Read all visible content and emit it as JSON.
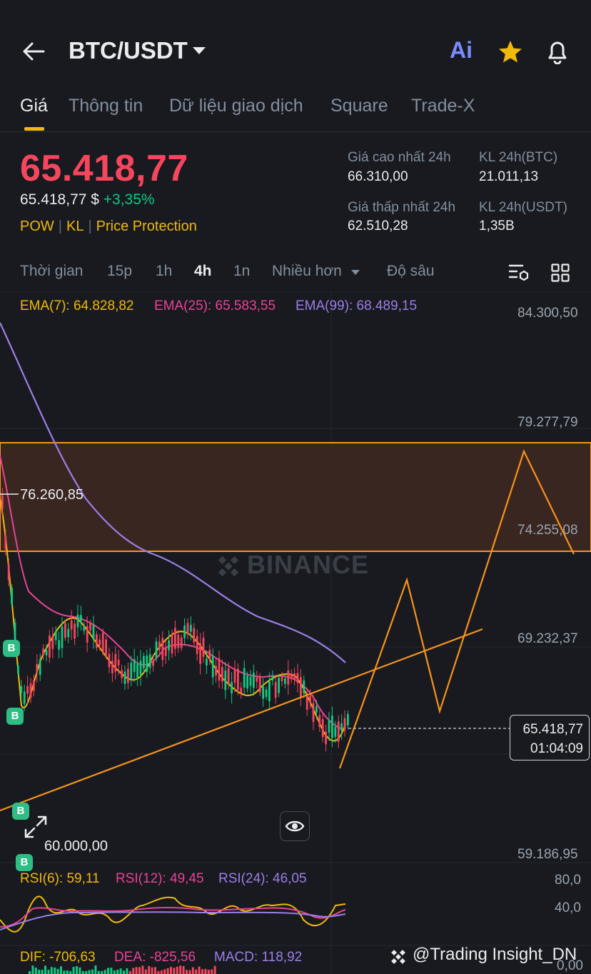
{
  "header": {
    "pair": "BTC/USDT",
    "ai_label": "Ai"
  },
  "tabs": [
    {
      "label": "Giá",
      "active": true
    },
    {
      "label": "Thông tin",
      "active": false
    },
    {
      "label": "Dữ liệu giao dịch",
      "active": false
    },
    {
      "label": "Square",
      "active": false
    },
    {
      "label": "Trade-X",
      "active": false
    }
  ],
  "price": {
    "last": "65.418,77",
    "fiat": "65.418,77 $",
    "change": "+3,35%",
    "tags": [
      "POW",
      "KL",
      "Price Protection"
    ]
  },
  "stats": {
    "high_label": "Giá cao nhất 24h",
    "high_value": "66.310,00",
    "vol_btc_label": "KL 24h(BTC)",
    "vol_btc_value": "21.011,13",
    "low_label": "Giá thấp nhất 24h",
    "low_value": "62.510,28",
    "vol_usdt_label": "KL 24h(USDT)",
    "vol_usdt_value": "1,35B"
  },
  "timeframes": [
    {
      "label": "Thời gian",
      "active": false
    },
    {
      "label": "15p",
      "active": false
    },
    {
      "label": "1h",
      "active": false
    },
    {
      "label": "4h",
      "active": true
    },
    {
      "label": "1n",
      "active": false
    },
    {
      "label": "Nhiều hơn",
      "active": false
    },
    {
      "label": "Độ sâu",
      "active": false
    }
  ],
  "ema": {
    "ema7": "EMA(7): 64.828,82",
    "ema25": "EMA(25): 65.583,55",
    "ema99": "EMA(99): 68.489,15"
  },
  "axis": {
    "y1": "84.300,50",
    "y2": "79.277,79",
    "y3": "74.255,08",
    "y4": "69.232,37",
    "y5": "59.186,95",
    "partial": "6"
  },
  "chart_labels": {
    "high_marker": "76.260,85",
    "low_marker": "60.000,00",
    "watermark": "BINANCE",
    "last_price": "65.418,77",
    "countdown": "01:04:09",
    "buy_marker": "B"
  },
  "rsi": {
    "rsi6": "RSI(6): 59,11",
    "rsi12": "RSI(12): 49,45",
    "rsi24": "RSI(24): 46,05",
    "axis_top": "80,0",
    "axis_mid": "40,0"
  },
  "macd": {
    "dif": "DIF: -706,63",
    "dea": "DEA: -825,56",
    "macd": "MACD: 118,92",
    "axis": "0,00"
  },
  "credit": "@Trading Insight_DN",
  "colors": {
    "up": "#0ecb81",
    "down": "#f6465d",
    "accent": "#f0b90b",
    "ema7": "#f0b90b",
    "ema25": "#e84393",
    "ema99": "#9b7fe6",
    "drawing": "#f7931a"
  }
}
